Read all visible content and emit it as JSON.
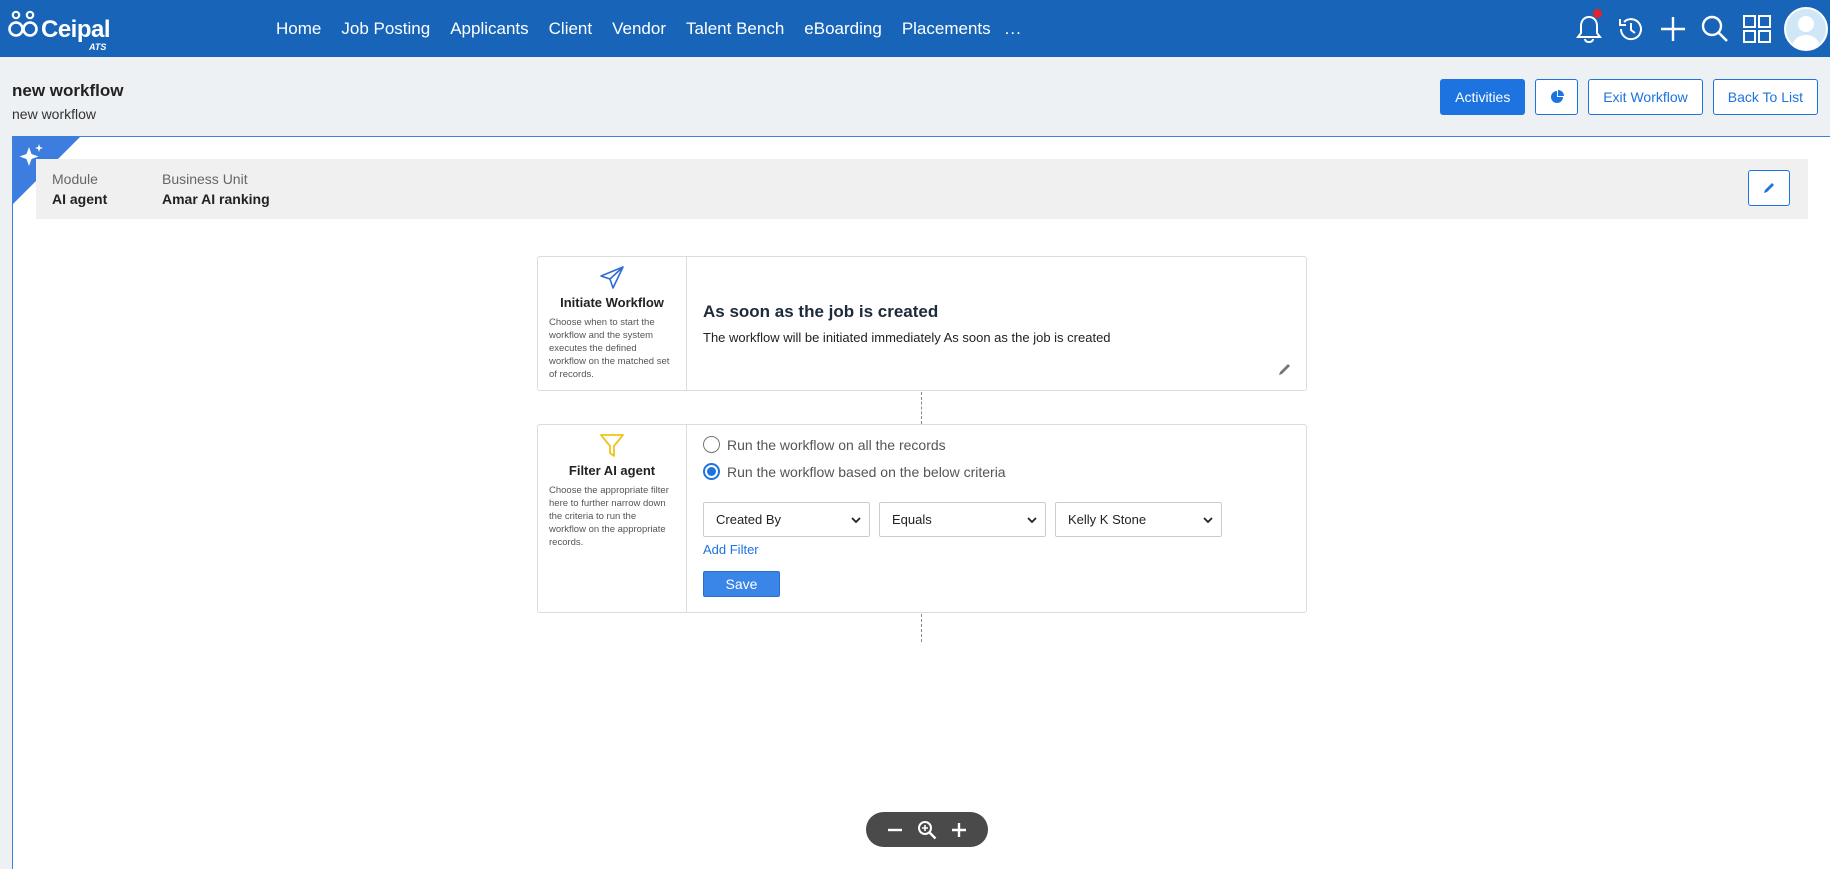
{
  "app": {
    "brand": "Ceipal",
    "product": "ATS"
  },
  "nav": {
    "items": [
      "Home",
      "Job Posting",
      "Applicants",
      "Client",
      "Vendor",
      "Talent Bench",
      "eBoarding",
      "Placements"
    ],
    "more": "..."
  },
  "top_icons": [
    "bell-icon",
    "history-icon",
    "plus-icon",
    "search-icon",
    "grid-icon",
    "avatar"
  ],
  "page": {
    "title": "new workflow",
    "subtitle": "new workflow"
  },
  "header_buttons": {
    "activities": "Activities",
    "chart_icon": "pie-chart-icon",
    "exit": "Exit Workflow",
    "back": "Back To List"
  },
  "info": {
    "module_label": "Module",
    "module_value": "AI agent",
    "bu_label": "Business Unit",
    "bu_value": "Amar AI ranking"
  },
  "initiate": {
    "title": "Initiate Workflow",
    "desc": "Choose when to start the workflow and the system executes the defined workflow on the matched set of records.",
    "heading": "As soon as the job is created",
    "text": "The workflow will be initiated immediately As soon as the job is created"
  },
  "filter": {
    "title": "Filter AI agent",
    "desc": "Choose the appropriate filter here to further narrow down the criteria to run the workflow on the appropriate records.",
    "option_all": "Run the workflow on all the records",
    "option_criteria": "Run the workflow based on the below criteria",
    "selected_option": "criteria",
    "field": "Created By",
    "operator": "Equals",
    "value": "Kelly K Stone",
    "add_filter": "Add Filter",
    "save": "Save"
  },
  "colors": {
    "nav_bg": "#1764b8",
    "accent": "#1d73e0",
    "notification": "#e0242f",
    "filter_icon": "#f0c419"
  }
}
